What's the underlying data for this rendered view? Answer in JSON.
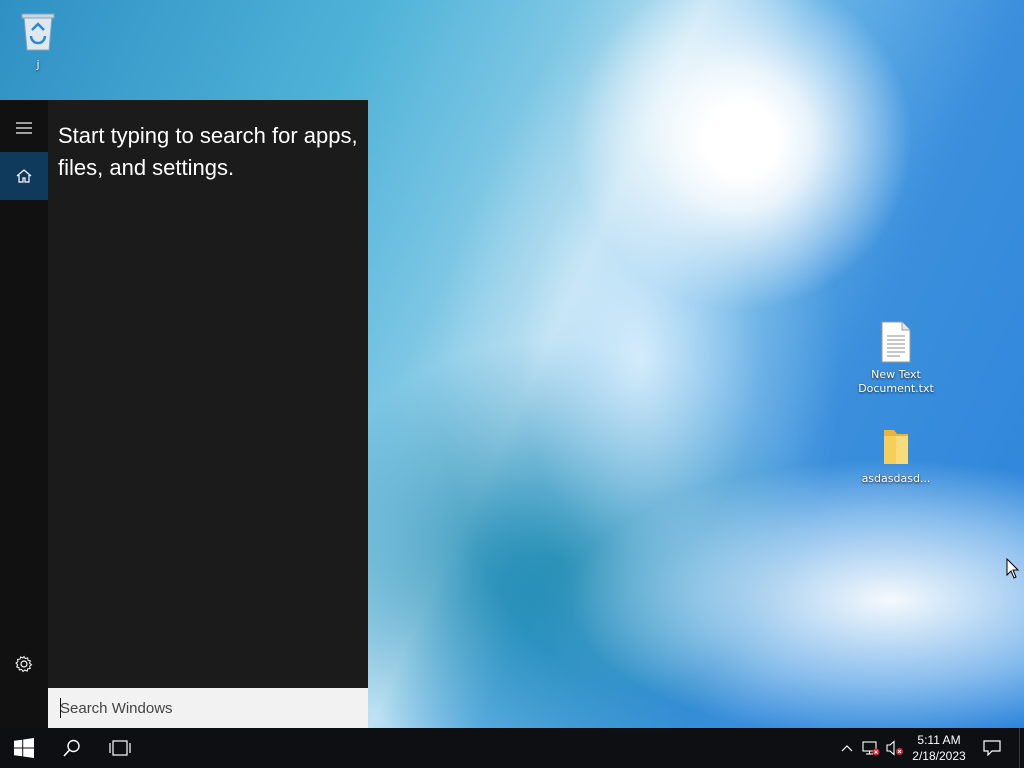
{
  "desktop": {
    "icons": [
      {
        "label": "j",
        "icon": "recycle-bin-icon"
      },
      {
        "label": "New Text Document.txt",
        "icon": "text-document-icon"
      },
      {
        "label": "asdasdasd...",
        "icon": "folder-icon"
      }
    ]
  },
  "start_panel": {
    "prompt": "Start typing to search for apps, files, and settings.",
    "rail": {
      "menu_icon": "hamburger-icon",
      "home_icon": "home-icon",
      "settings_icon": "gear-icon"
    },
    "search": {
      "placeholder": "Search Windows",
      "value": ""
    }
  },
  "taskbar": {
    "start_icon": "windows-logo-icon",
    "search_icon": "search-icon",
    "taskview_icon": "task-view-icon",
    "tray": {
      "chevron_icon": "chevron-up-icon",
      "network_icon": "network-error-icon",
      "volume_icon": "volume-muted-icon"
    },
    "clock": {
      "time": "5:11 AM",
      "date": "2/18/2023"
    },
    "notification_icon": "action-center-icon"
  },
  "colors": {
    "panel_bg": "#1b1b1b",
    "rail_bg": "#111111",
    "home_highlight": "#0f3a5c",
    "taskbar_bg": "#0d0f12",
    "search_bg": "#f2f2f2"
  }
}
